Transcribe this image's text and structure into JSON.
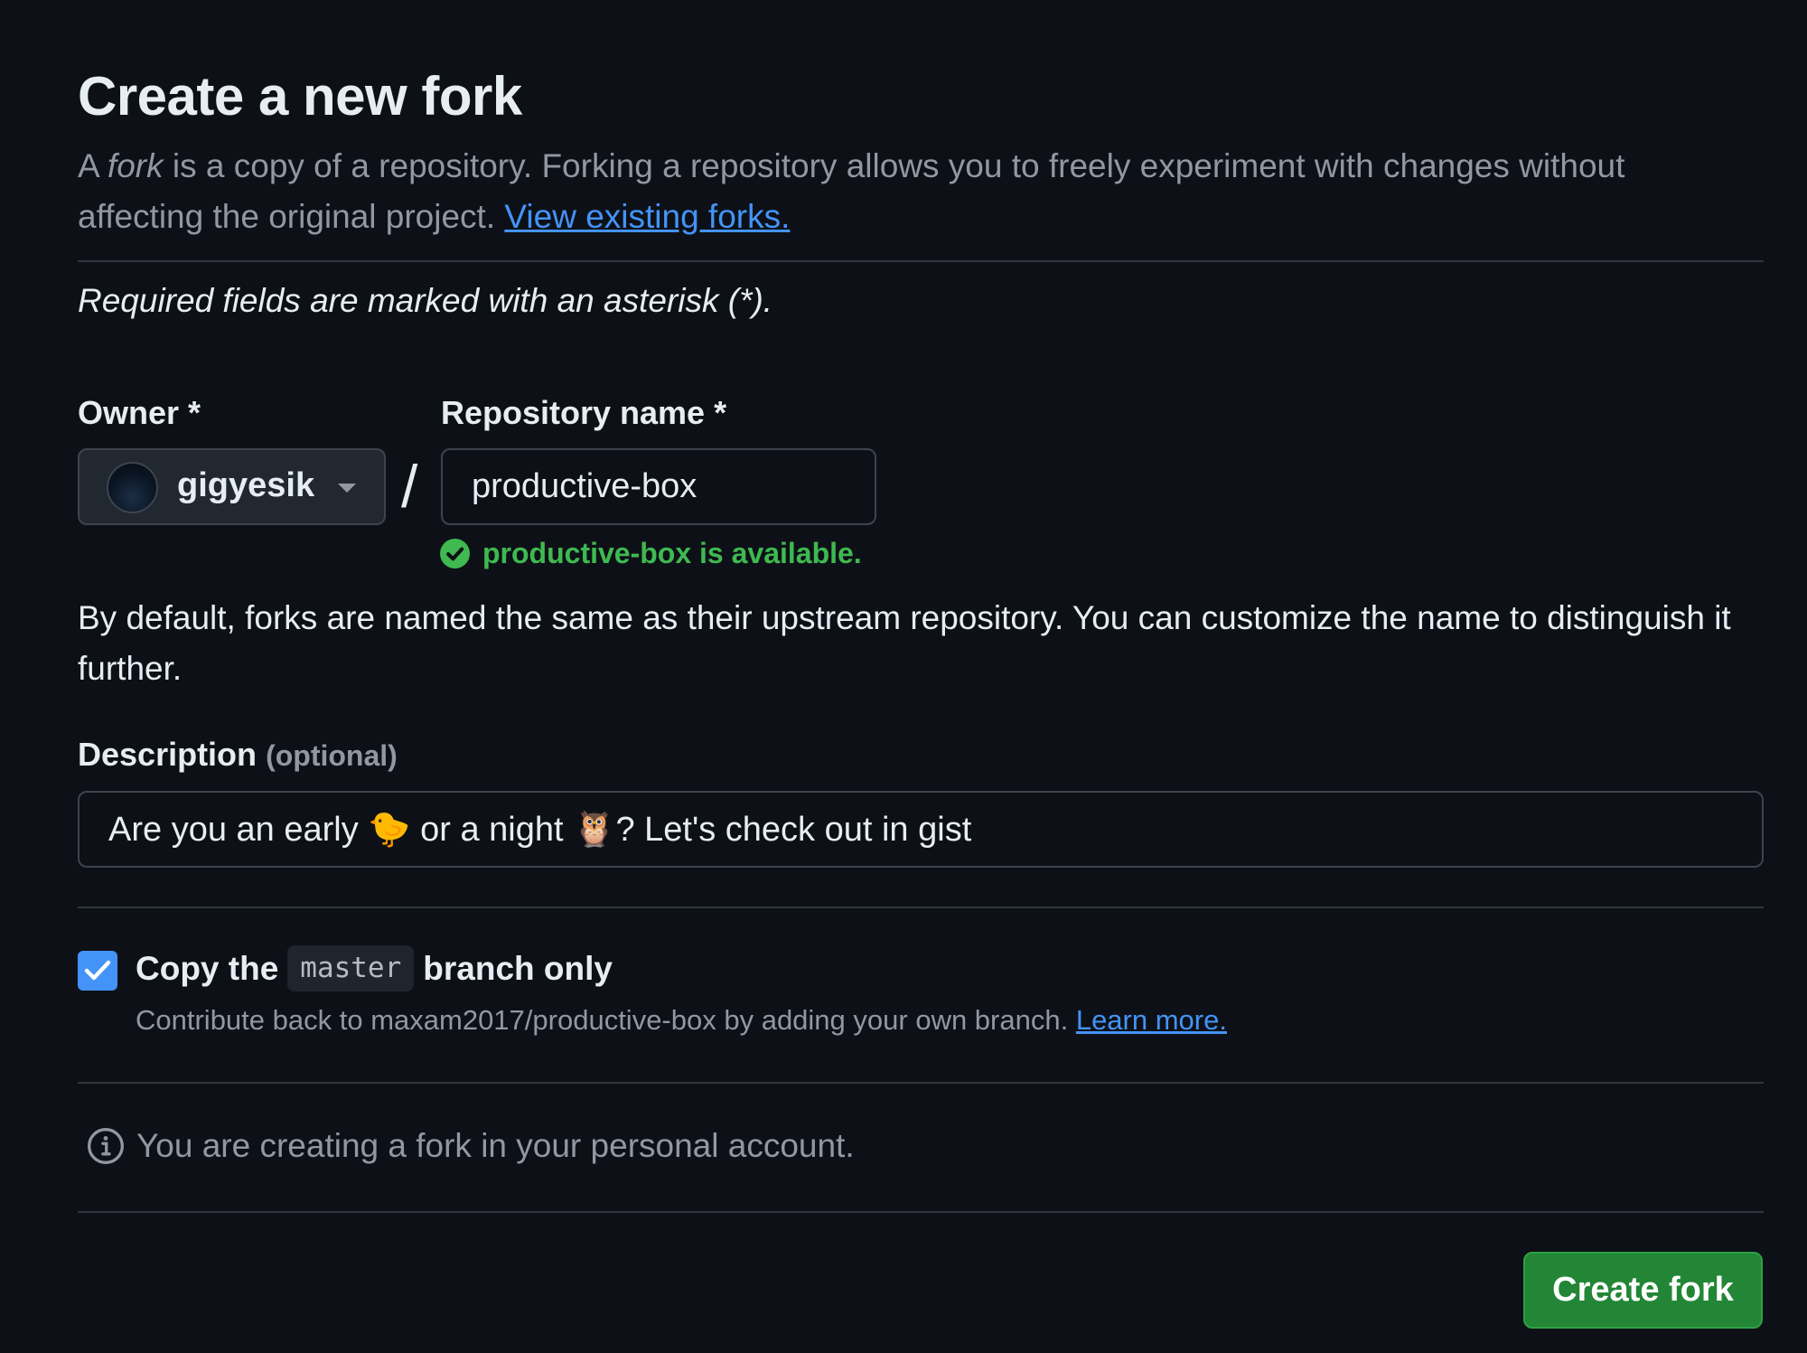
{
  "page": {
    "title": "Create a new fork",
    "intro_prefix": "A ",
    "intro_fork_word": "fork",
    "intro_rest": " is a copy of a repository. Forking a repository allows you to freely experiment with changes without affecting the original project. ",
    "view_forks_link": "View existing forks.",
    "required_note": "Required fields are marked with an asterisk (*)."
  },
  "owner": {
    "label": "Owner *",
    "value": "gigyesik"
  },
  "separator": "/",
  "repository": {
    "label": "Repository name *",
    "value": "productive-box",
    "availability": "productive-box is available."
  },
  "default_note": "By default, forks are named the same as their upstream repository. You can customize the name to distinguish it further.",
  "description": {
    "label": "Description",
    "optional": "(optional)",
    "value": "Are you an early 🐤 or a night 🦉? Let's check out in gist"
  },
  "copy_branch": {
    "checked": true,
    "label_prefix": "Copy the",
    "branch": "master",
    "label_suffix": "branch only",
    "sub_text": "Contribute back to maxam2017/productive-box by adding your own branch. ",
    "learn_more": "Learn more."
  },
  "info": {
    "icon": "info-icon",
    "text": "You are creating a fork in your personal account."
  },
  "actions": {
    "create_label": "Create fork"
  },
  "colors": {
    "background": "#0d1117",
    "link": "#4493f8",
    "success": "#3fb950",
    "primary_button": "#238636",
    "checkbox": "#4493f8"
  }
}
